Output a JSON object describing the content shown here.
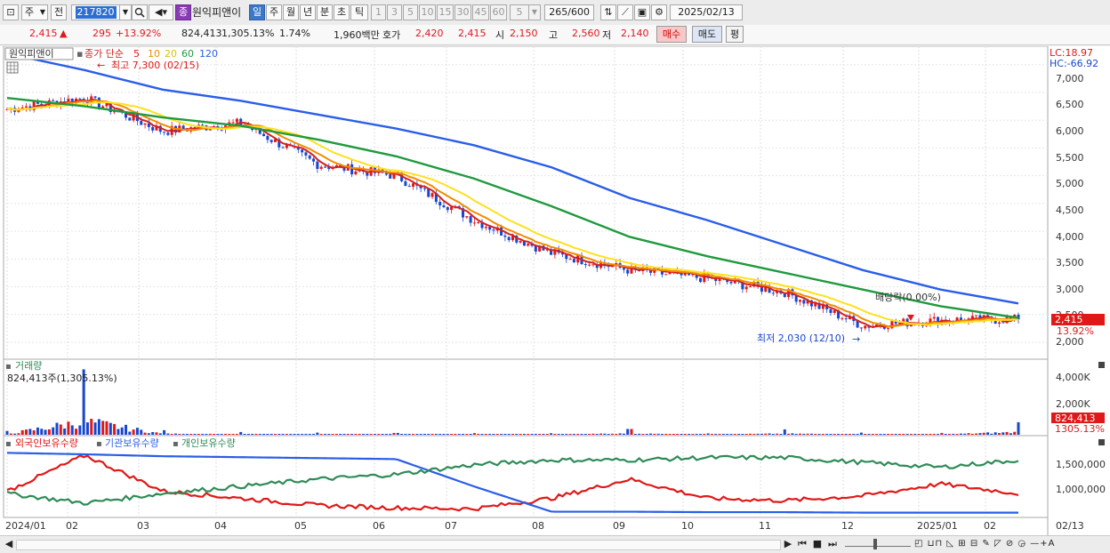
{
  "toolbar": {
    "market": "주",
    "type": "전",
    "code": "217820",
    "name": "원익피앤이",
    "badge": "종",
    "periods": [
      "일",
      "주",
      "월",
      "년",
      "분",
      "초",
      "틱"
    ],
    "selected_period": "일",
    "minutes": [
      "1",
      "3",
      "5",
      "10",
      "15",
      "30",
      "45",
      "60"
    ],
    "interval_value": "5",
    "count": "265/600",
    "date": "2025/02/13"
  },
  "quote": {
    "price": "2,415",
    "change": "295",
    "change_pct": "+13.92%",
    "volume": "824,413",
    "volume_pct": "1,305.13%",
    "turnover_pct": "1.74%",
    "amount": "1,960백만",
    "ask_label": "호가",
    "ask1": "2,420",
    "ask2": "2,415",
    "open_label": "시",
    "open": "2,150",
    "high_label": "고",
    "high": "2,560",
    "low_label": "저",
    "low": "2,140",
    "buy": "매수",
    "sell": "매도",
    "eval": "평"
  },
  "price_panel": {
    "stock_name": "원익피앤이",
    "ma_label": "종가 단순",
    "ma_periods": [
      "5",
      "10",
      "20",
      "60",
      "120"
    ],
    "ma_colors": [
      "#d42020",
      "#f08c00",
      "#ffe01e",
      "#1f9a3e",
      "#2a5ee8"
    ],
    "lc": "LC:18.97",
    "hc": "HC:-66.92",
    "max_annotation": "최고 7,300 (02/15)",
    "min_annotation": "최저 2,030 (12/10)",
    "dividend_annotation": "배당락(0.00%)",
    "y_ticks": [
      "7,000",
      "6,500",
      "6,000",
      "5,500",
      "5,000",
      "4,500",
      "4,000",
      "3,500",
      "3,000",
      "2,500",
      "2,000"
    ],
    "last_price": "2,415",
    "last_pct": "13.92%"
  },
  "volume_panel": {
    "title": "거래량",
    "info": "824,413주(1,305.13%)",
    "y_ticks": [
      "4,000K",
      "2,000K"
    ],
    "last_value": "824,413",
    "last_pct": "1305.13%"
  },
  "holding_panel": {
    "titles": [
      "외국인보유수량",
      "기관보유수량",
      "개인보유수량"
    ],
    "colors": [
      "#e01818",
      "#2a5ee8",
      "#2e8b57"
    ],
    "y_ticks": [
      "1,500,000",
      "1,000,000"
    ]
  },
  "x_axis": {
    "labels": [
      "2024/01",
      "02",
      "03",
      "04",
      "05",
      "06",
      "07",
      "08",
      "09",
      "10",
      "11",
      "12",
      "2025/01",
      "02"
    ],
    "right_label": "02/13"
  },
  "chart_data": {
    "type": "line",
    "title": "원익피앤이",
    "x": [
      "2024/01",
      "02",
      "03",
      "04",
      "05",
      "06",
      "07",
      "08",
      "09",
      "10",
      "11",
      "12",
      "2025/01",
      "02"
    ],
    "series": [
      {
        "name": "종가",
        "values": [
          6200,
          6400,
          5800,
          5950,
          5200,
          5000,
          4200,
          3600,
          3300,
          3150,
          2900,
          2300,
          2400,
          2415
        ]
      },
      {
        "name": "60",
        "values": [
          6400,
          6250,
          6050,
          5900,
          5650,
          5350,
          4950,
          4450,
          3900,
          3550,
          3250,
          2950,
          2650,
          2440
        ]
      },
      {
        "name": "120",
        "values": [
          7200,
          6900,
          6550,
          6350,
          6100,
          5850,
          5550,
          5150,
          4600,
          4200,
          3750,
          3300,
          2950,
          2700
        ]
      }
    ],
    "ylim": [
      2000,
      7300
    ],
    "volume": {
      "name": "거래량",
      "unit": "K",
      "values": [
        250,
        4300,
        300,
        180,
        140,
        120,
        110,
        100,
        380,
        90,
        350,
        140,
        120,
        824
      ]
    },
    "holdings": [
      {
        "name": "외국인보유수량",
        "values": [
          1050000,
          1800000,
          1050000,
          900000,
          750000,
          700000,
          680000,
          900000,
          1300000,
          900000,
          850000,
          950000,
          1200000,
          1000000
        ]
      },
      {
        "name": "기관보유수량",
        "values": [
          1850000,
          1820000,
          1780000,
          1760000,
          1740000,
          1720000,
          1150000,
          620000,
          620000,
          610000,
          610000,
          600000,
          600000,
          600000
        ]
      },
      {
        "name": "개인보유수량",
        "values": [
          1000000,
          800000,
          1000000,
          1150000,
          1300000,
          1400000,
          1600000,
          1700000,
          1700000,
          1750000,
          1750000,
          1650000,
          1550000,
          1700000
        ]
      }
    ]
  }
}
